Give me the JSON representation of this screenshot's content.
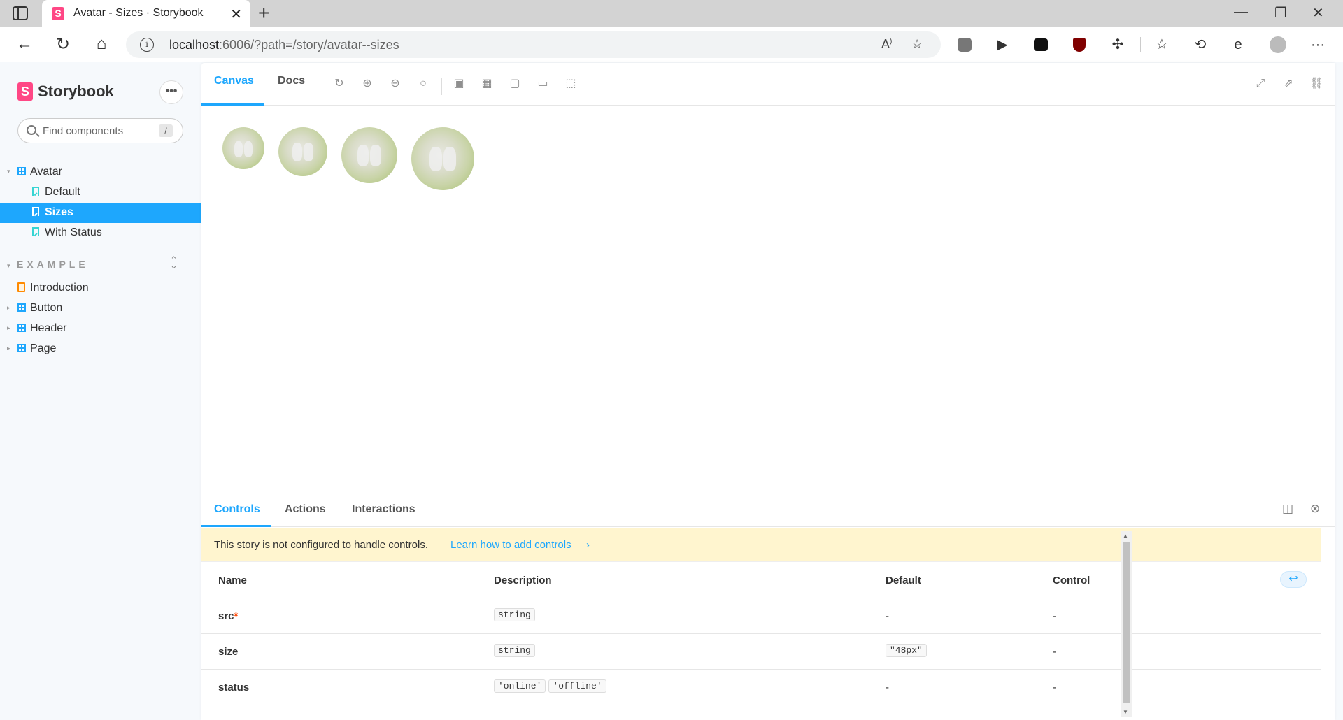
{
  "browser": {
    "tab_title": "Avatar - Sizes · Storybook",
    "favicon_letter": "S",
    "new_tab": "+",
    "url_host": "localhost",
    "url_rest": ":6006/?path=/story/avatar--sizes",
    "minimize": "—",
    "restore": "❐",
    "close": "✕"
  },
  "sidebar": {
    "logo_letter": "S",
    "brand": "Storybook",
    "menu": "•••",
    "search_placeholder": "Find components",
    "search_shortcut": "/",
    "tree": {
      "avatar": "Avatar",
      "default": "Default",
      "sizes": "Sizes",
      "with_status": "With Status"
    },
    "group_title": "EXAMPLE",
    "example_items": [
      "Introduction",
      "Button",
      "Header",
      "Page"
    ]
  },
  "toolbar": {
    "tabs": [
      "Canvas",
      "Docs"
    ]
  },
  "addons": {
    "tabs": [
      "Controls",
      "Actions",
      "Interactions"
    ],
    "notice": "This story is not configured to handle controls.",
    "notice_link": "Learn how to add controls",
    "notice_chevron": "›",
    "table": {
      "headers": [
        "Name",
        "Description",
        "Default",
        "Control"
      ],
      "rows": [
        {
          "name": "src",
          "required": "*",
          "types": [
            "string"
          ],
          "default": "-",
          "control": "-"
        },
        {
          "name": "size",
          "required": "",
          "types": [
            "string"
          ],
          "default": "\"48px\"",
          "control": "-"
        },
        {
          "name": "status",
          "required": "",
          "types": [
            "'online'",
            "'offline'"
          ],
          "default": "-",
          "control": "-"
        }
      ]
    }
  },
  "colors": {
    "accent": "#1ea7fd",
    "brand": "#ff4785",
    "notice_bg": "#fff5cf"
  }
}
